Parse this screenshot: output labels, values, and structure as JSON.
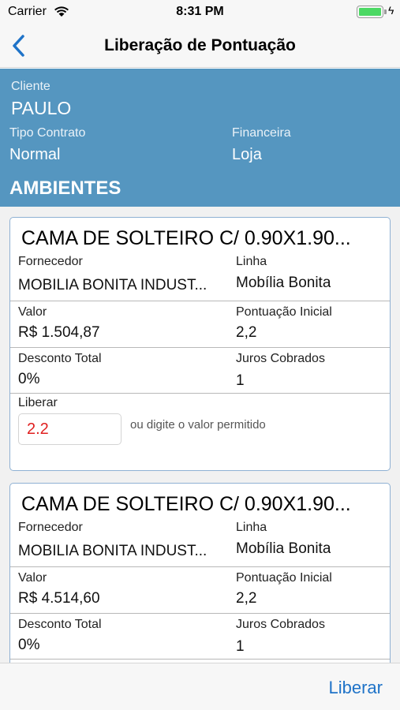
{
  "status_bar": {
    "carrier": "Carrier",
    "time": "8:31 PM"
  },
  "nav": {
    "title": "Liberação de Pontuação",
    "back_icon": "chevron-left-icon"
  },
  "header": {
    "cliente_label": "Cliente",
    "cliente_value": "PAULO",
    "tipo_contrato_label": "Tipo Contrato",
    "tipo_contrato_value": "Normal",
    "financeira_label": "Financeira",
    "financeira_value": "Loja",
    "section_title": "AMBIENTES"
  },
  "items": [
    {
      "title": "CAMA DE SOLTEIRO C/ 0.90X1.90...",
      "fornecedor_label": "Fornecedor",
      "fornecedor_value": "MOBILIA BONITA INDUST...",
      "linha_label": "Linha",
      "linha_value": "Mobília Bonita",
      "valor_label": "Valor",
      "valor_value": "R$ 1.504,87",
      "pontuacao_label": "Pontuação Inicial",
      "pontuacao_value": "2,2",
      "desconto_label": "Desconto Total",
      "desconto_value": "0%",
      "juros_label": "Juros Cobrados",
      "juros_value": "1",
      "liberar_label": "Liberar",
      "liberar_value": "2.2",
      "hint": "ou digite o valor permitido"
    },
    {
      "title": "CAMA DE SOLTEIRO C/ 0.90X1.90...",
      "fornecedor_label": "Fornecedor",
      "fornecedor_value": "MOBILIA BONITA INDUST...",
      "linha_label": "Linha",
      "linha_value": "Mobília Bonita",
      "valor_label": "Valor",
      "valor_value": "R$ 4.514,60",
      "pontuacao_label": "Pontuação Inicial",
      "pontuacao_value": "2,2",
      "desconto_label": "Desconto Total",
      "desconto_value": "0%",
      "juros_label": "Juros Cobrados",
      "juros_value": "1"
    }
  ],
  "toolbar": {
    "liberar_button": "Liberar"
  },
  "colors": {
    "header_bg": "#5596c0",
    "accent": "#1f73c8",
    "input_text": "#e02020",
    "battery": "#4cd964"
  }
}
